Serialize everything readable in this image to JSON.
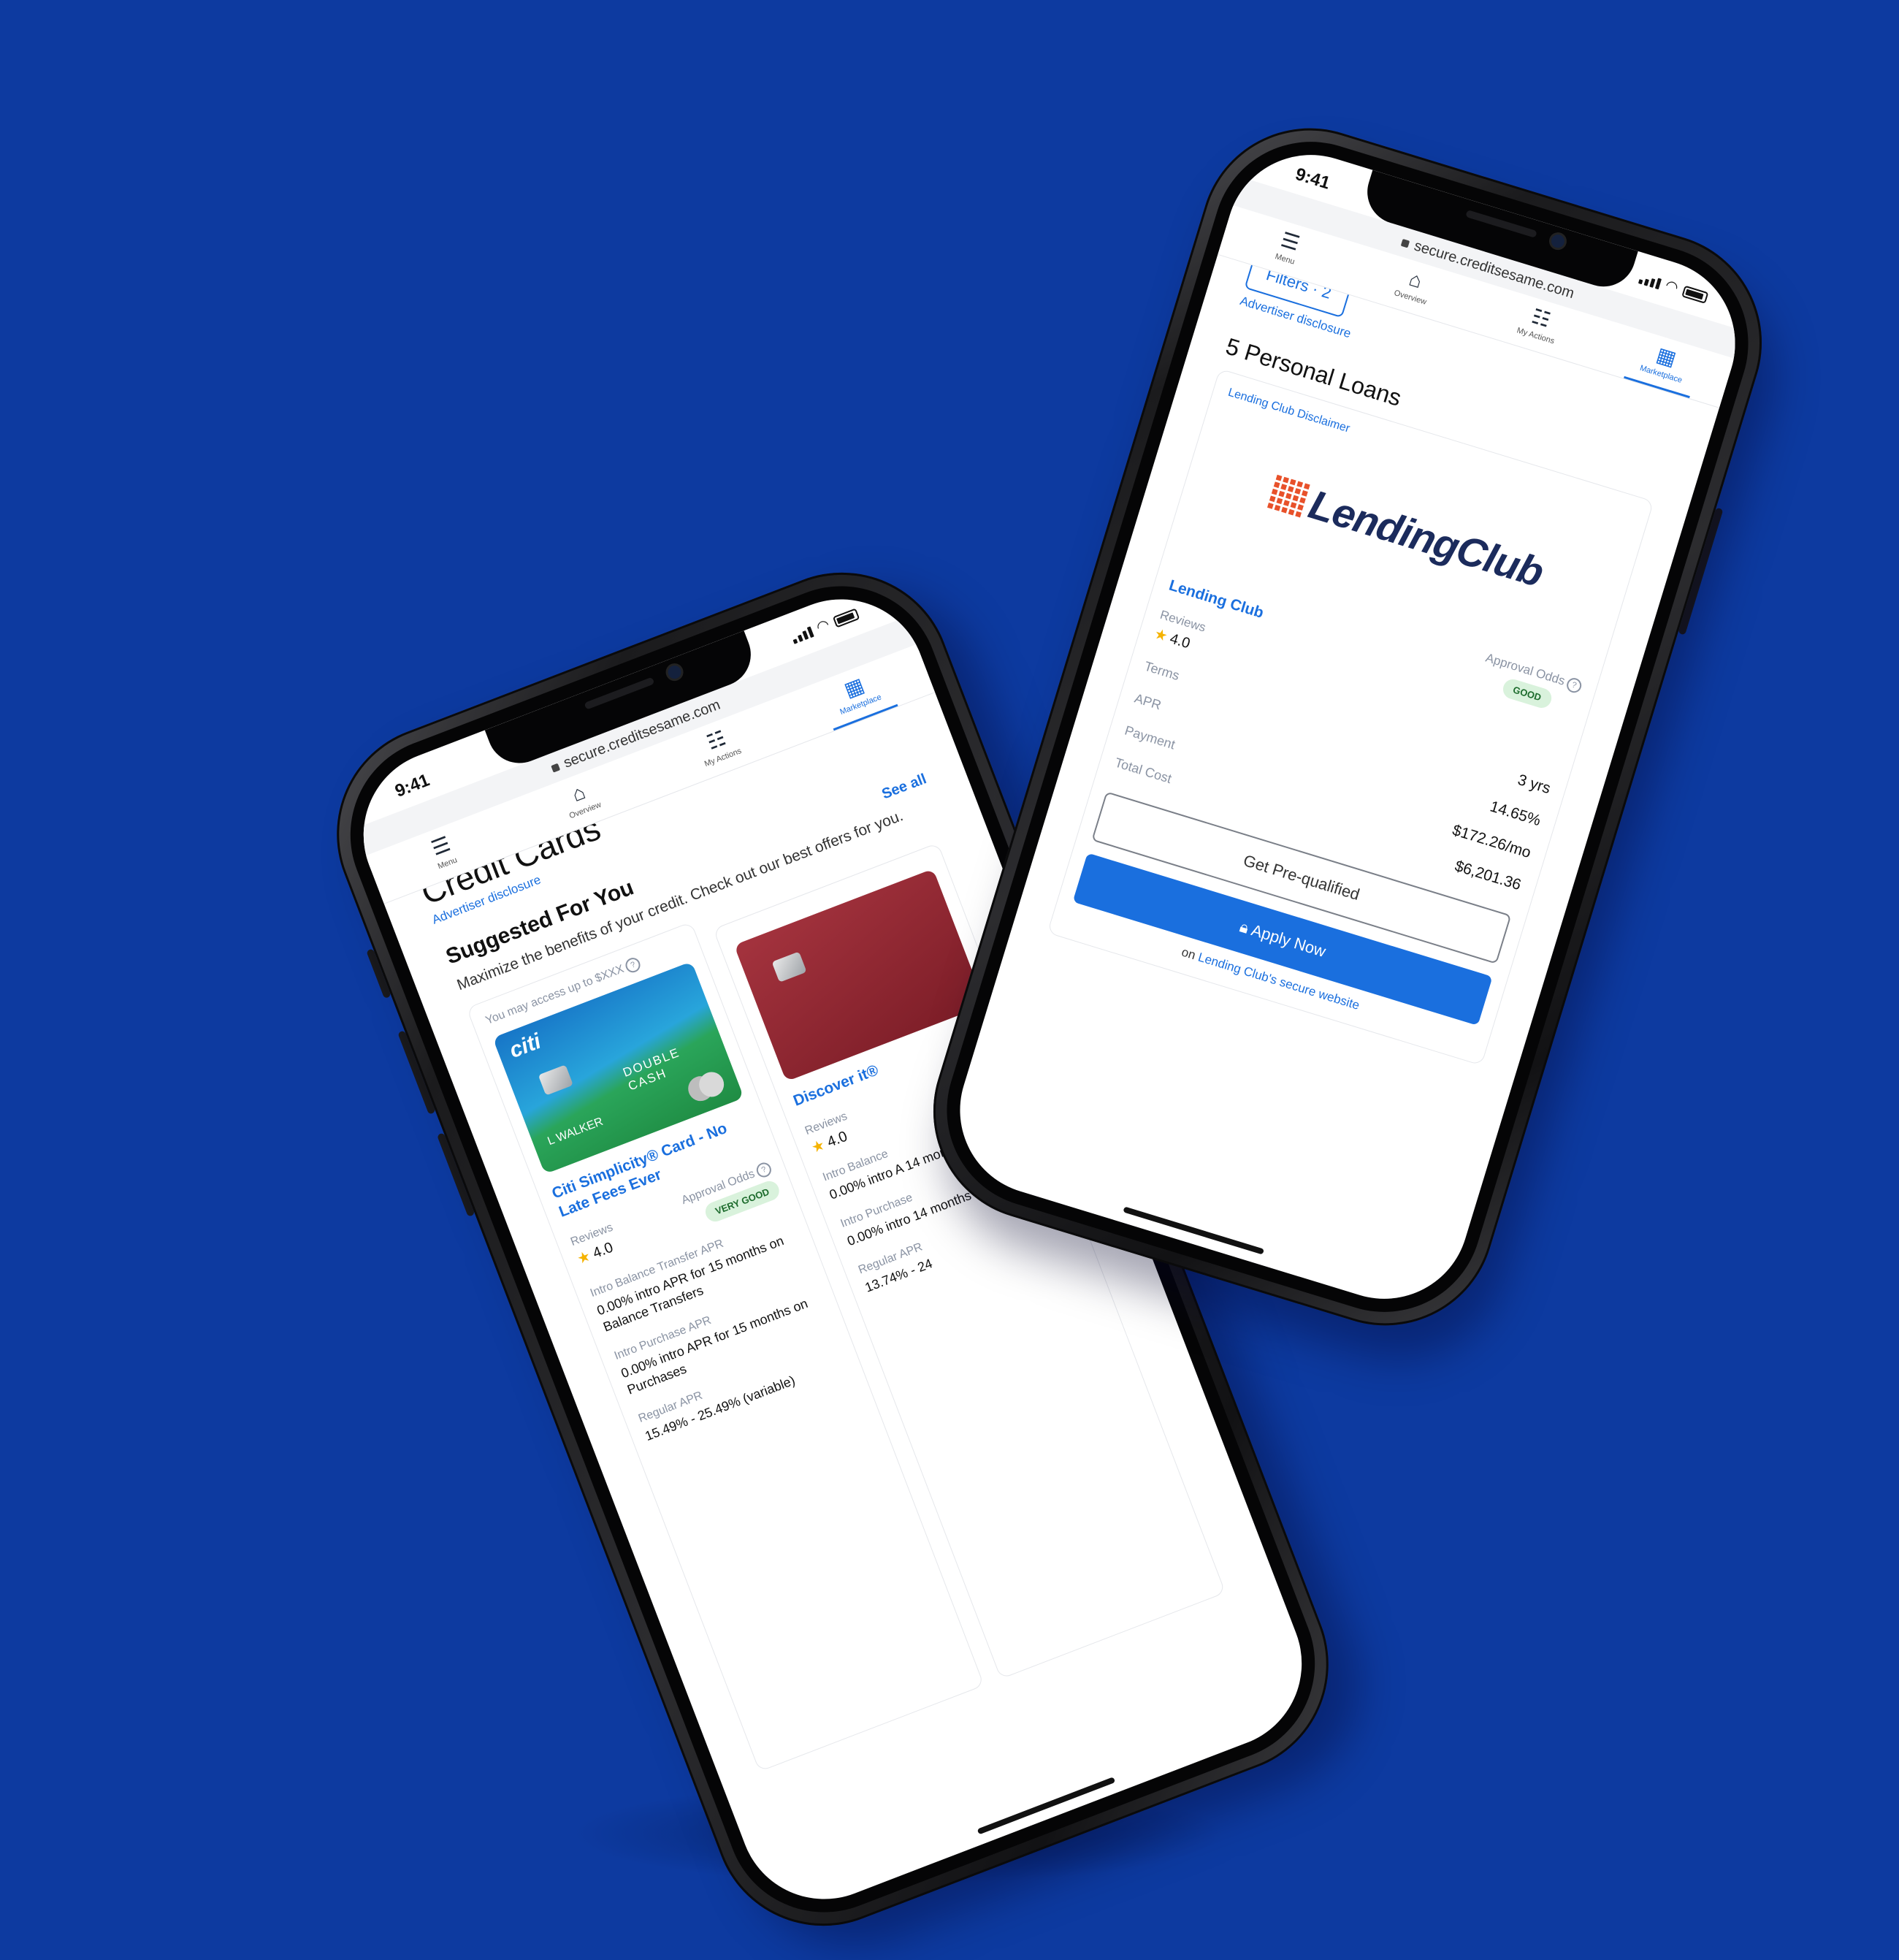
{
  "background_color": "#0d3aa0",
  "accent_color": "#1a6fde",
  "phone_common": {
    "time": "9:41",
    "url": "secure.creditsesame.com",
    "nav": [
      {
        "label": "Menu",
        "icon": "menu-icon",
        "glyph": "☰"
      },
      {
        "label": "Overview",
        "icon": "home-icon",
        "glyph": "⌂"
      },
      {
        "label": "My Actions",
        "icon": "checklist-icon",
        "glyph": "☷"
      },
      {
        "label": "Marketplace",
        "icon": "store-icon",
        "glyph": "▦"
      }
    ]
  },
  "credit_cards_screen": {
    "title": "Credit Cards",
    "advertiser_disclosure": "Advertiser disclosure",
    "section_title": "Suggested For You",
    "see_all": "See all",
    "subtitle": "Maximize the benefits of your credit. Check out our best offers for you.",
    "access_note": "You may access up to $XXX",
    "cards": [
      {
        "brand": "citi",
        "art_text": "DOUBLE CASH",
        "cardholder": "L WALKER",
        "name": "Citi Simplicity® Card - No Late Fees Ever",
        "reviews_label": "Reviews",
        "rating": "4.0",
        "odds_label": "Approval Odds",
        "odds": "VERY GOOD",
        "intro_bt_label": "Intro Balance Transfer APR",
        "intro_bt": "0.00% intro APR for 15 months on Balance Transfers",
        "intro_purchase_label": "Intro Purchase APR",
        "intro_purchase": "0.00% intro APR for 15 months on Purchases",
        "regular_apr_label": "Regular APR",
        "regular_apr": "15.49% - 25.49% (variable)"
      },
      {
        "name": "Discover it®",
        "reviews_label": "Reviews",
        "rating": "4.0",
        "intro_bt_label": "Intro Balance",
        "intro_bt": "0.00% intro A 14 months",
        "intro_purchase_label": "Intro Purchase",
        "intro_purchase": "0.00% intro 14 months",
        "regular_apr_label": "Regular APR",
        "regular_apr": "13.74% - 24"
      }
    ]
  },
  "personal_loans_screen": {
    "filters_label": "Filters",
    "filters_count": "· 2",
    "advertiser_disclosure": "Advertiser disclosure",
    "title": "5 Personal Loans",
    "lender_disclaimer": "Lending Club Disclaimer",
    "lender_logo_text": "LendingClub",
    "lender_name": "Lending Club",
    "odds_label": "Approval Odds",
    "odds": "GOOD",
    "reviews_label": "Reviews",
    "rating": "4.0",
    "rows": [
      {
        "label": "Terms",
        "value": "3 yrs"
      },
      {
        "label": "APR",
        "value": "14.65%"
      },
      {
        "label": "Payment",
        "value": "$172.26/mo"
      },
      {
        "label": "Total Cost",
        "value": "$6,201.36"
      }
    ],
    "prequalify_button": "Get Pre-qualified",
    "apply_button": "Apply Now",
    "secure_note_prefix": "on ",
    "secure_note_link": "Lending Club's secure website"
  }
}
